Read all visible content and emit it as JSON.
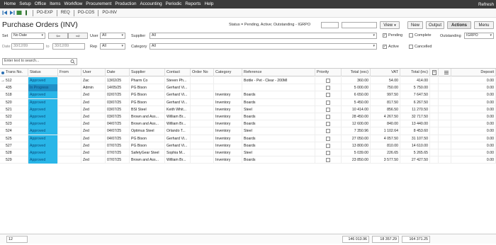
{
  "menu": [
    "Home",
    "Setup",
    "Office",
    "Items",
    "Workflow",
    "Procurement",
    "Production",
    "Accounting",
    "Periodic",
    "Reports",
    "Help"
  ],
  "menu_refresh": "Refresh",
  "tabs": [
    "PO-EXP",
    "REQ",
    "PO-COS",
    "PO-INV"
  ],
  "page_title": "Purchase Orders (INV)",
  "status_line": "Status = Pending, Active; Outstanding - IGRPO",
  "view_label": "View",
  "buttons": {
    "new": "New",
    "output": "Output",
    "actions": "Actions",
    "menu": "Menu"
  },
  "filters": {
    "set_label": "Set",
    "set_value": "No Date",
    "date_label": "Date",
    "date_from": "30/12/99",
    "to_label": "to",
    "date_to": "30/12/99",
    "user_label": "User",
    "user_value": "All",
    "rep_label": "Rep",
    "rep_value": "All",
    "supplier_label": "Supplier",
    "supplier_value": "All",
    "category_label": "Category",
    "category_value": "All",
    "pending_label": "Pending",
    "complete_label": "Complete",
    "active_label": "Active",
    "cancelled_label": "Cancelled",
    "outstanding_label": "Outstanding",
    "outstanding_value": "IGRPO"
  },
  "search_placeholder": "Enter text to search...",
  "columns": [
    "Trans No.",
    "Status",
    "From",
    "User",
    "Date",
    "Supplier",
    "Contact",
    "Order No",
    "Category",
    "Reference",
    "Priority",
    "Total (exc)",
    "VAT",
    "Total (inc)",
    "",
    "",
    "Deposit"
  ],
  "rows": [
    {
      "trans": "512",
      "status": "Approved",
      "user": "Zac",
      "date": "13/02/25",
      "supplier": "Pharm Co",
      "contact": "Steven Ph...",
      "category": "",
      "reference": "Bottle - Pet - Clear - 200Ml",
      "exc": "360.00",
      "vat": "54.00",
      "inc": "414.00",
      "deposit": "0.00"
    },
    {
      "trans": "435",
      "status": "In Progress",
      "user": "Admin",
      "date": "14/05/25",
      "supplier": "PG Bison",
      "contact": "Gerhard Vi...",
      "category": "",
      "reference": "",
      "exc": "5 000.00",
      "vat": "750.00",
      "inc": "5 750.00",
      "deposit": "0.00"
    },
    {
      "trans": "518",
      "status": "Approved",
      "user": "Zed",
      "date": "02/07/25",
      "supplier": "PG Bison",
      "contact": "Gerhard Vi...",
      "category": "Inventory",
      "reference": "Boards",
      "exc": "6 650.00",
      "vat": "997.50",
      "inc": "7 647.50",
      "deposit": "0.00"
    },
    {
      "trans": "520",
      "status": "Approved",
      "user": "Zed",
      "date": "03/07/25",
      "supplier": "PG Bison",
      "contact": "Gerhard Vi...",
      "category": "Inventory",
      "reference": "Boards",
      "exc": "5 450.00",
      "vat": "817.50",
      "inc": "6 267.50",
      "deposit": "0.00"
    },
    {
      "trans": "521",
      "status": "Approved",
      "user": "Zed",
      "date": "03/07/25",
      "supplier": "BSI Steel",
      "contact": "Keith Whit...",
      "category": "Inventory",
      "reference": "Steel",
      "exc": "10 414.00",
      "vat": "856.50",
      "inc": "11 270.50",
      "deposit": "0.00"
    },
    {
      "trans": "522",
      "status": "Approved",
      "user": "Zed",
      "date": "03/07/25",
      "supplier": "Brown and Ass...",
      "contact": "William Br...",
      "category": "Inventory",
      "reference": "Boards",
      "exc": "28 450.00",
      "vat": "4 267.50",
      "inc": "32 717.50",
      "deposit": "0.00"
    },
    {
      "trans": "523",
      "status": "Approved",
      "user": "Zed",
      "date": "04/07/25",
      "supplier": "Brown and Ass...",
      "contact": "William Br...",
      "category": "Inventory",
      "reference": "Boards",
      "exc": "12 600.00",
      "vat": "840.00",
      "inc": "13 440.00",
      "deposit": "0.00"
    },
    {
      "trans": "524",
      "status": "Approved",
      "user": "Zed",
      "date": "04/07/25",
      "supplier": "Optimus Steel",
      "contact": "Orlando T...",
      "category": "Inventory",
      "reference": "Steel",
      "exc": "7 350.96",
      "vat": "1 102.64",
      "inc": "8 453.60",
      "deposit": "0.00"
    },
    {
      "trans": "525",
      "status": "Approved",
      "user": "Zed",
      "date": "04/07/25",
      "supplier": "PG Bison",
      "contact": "Gerhard Vi...",
      "category": "Inventory",
      "reference": "Boards",
      "exc": "27 050.00",
      "vat": "4 057.50",
      "inc": "31 107.50",
      "deposit": "0.00"
    },
    {
      "trans": "527",
      "status": "Approved",
      "user": "Zed",
      "date": "07/07/25",
      "supplier": "PG Bison",
      "contact": "Gerhard Vi...",
      "category": "Inventory",
      "reference": "Boards",
      "exc": "13 800.00",
      "vat": "810.00",
      "inc": "14 610.00",
      "deposit": "0.00"
    },
    {
      "trans": "528",
      "status": "Approved",
      "user": "Zed",
      "date": "07/07/25",
      "supplier": "SafetyGear Steel",
      "contact": "Sophia M...",
      "category": "Inventory",
      "reference": "Steel",
      "exc": "5 039.00",
      "vat": "226.65",
      "inc": "5 265.65",
      "deposit": "0.00"
    },
    {
      "trans": "529",
      "status": "Approved",
      "user": "Zed",
      "date": "07/07/25",
      "supplier": "Brown and Ass...",
      "contact": "William Br...",
      "category": "Inventory",
      "reference": "Boards",
      "exc": "23 850.00",
      "vat": "3 577.50",
      "inc": "27 427.50",
      "deposit": "0.00"
    }
  ],
  "footer": {
    "count": "12",
    "total_exc": "146 013.96",
    "total_vat": "18 357.29",
    "total_inc": "164 371.25"
  },
  "colors": {
    "menubar": "#3b3b3b",
    "approved": "#29b6e8",
    "in_progress": "#1f8fc7"
  }
}
